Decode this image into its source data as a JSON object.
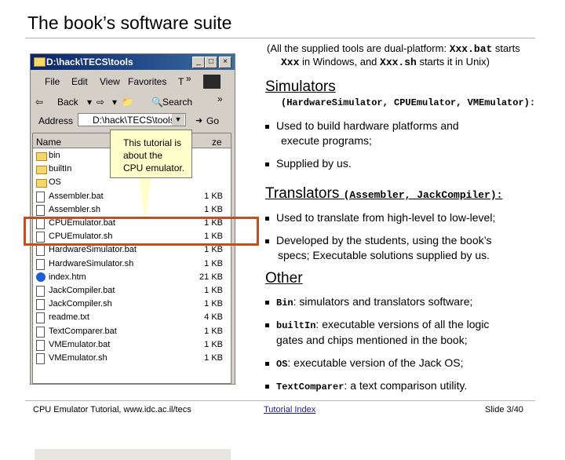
{
  "slide": {
    "title": "The book’s software suite",
    "intro_line1": "(All the supplied tools are dual-platform: ",
    "intro_code1": "Xxx.bat",
    "intro_line1b": " starts",
    "intro_code2": "Xxx",
    "intro_line2": " in Windows, and ",
    "intro_code3": "Xxx.sh",
    "intro_line2b": " starts it in Unix)"
  },
  "explorer": {
    "title": "D:\\hack\\TECS\\tools",
    "menu": [
      "File",
      "Edit",
      "View",
      "Favorites",
      "T",
      "»"
    ],
    "toolbar": [
      "Back",
      "Search",
      "»"
    ],
    "address_label": "Address",
    "address_value": "D:\\hack\\TECS\\tools",
    "go_label": "Go",
    "columns": [
      "Name",
      "ze"
    ],
    "files": [
      {
        "name": "bin",
        "size": "",
        "type": "folder"
      },
      {
        "name": "builtIn",
        "size": "",
        "type": "folder"
      },
      {
        "name": "OS",
        "size": "",
        "type": "folder"
      },
      {
        "name": "Assembler.bat",
        "size": "1 KB",
        "type": "file"
      },
      {
        "name": "Assembler.sh",
        "size": "1 KB",
        "type": "file"
      },
      {
        "name": "CPUEmulator.bat",
        "size": "1 KB",
        "type": "file"
      },
      {
        "name": "CPUEmulator.sh",
        "size": "1 KB",
        "type": "file"
      },
      {
        "name": "HardwareSimulator.bat",
        "size": "1 KB",
        "type": "file"
      },
      {
        "name": "HardwareSimulator.sh",
        "size": "1 KB",
        "type": "file"
      },
      {
        "name": "index.htm",
        "size": "21 KB",
        "type": "ie"
      },
      {
        "name": "JackCompiler.bat",
        "size": "1 KB",
        "type": "file"
      },
      {
        "name": "JackCompiler.sh",
        "size": "1 KB",
        "type": "file"
      },
      {
        "name": "readme.txt",
        "size": "4 KB",
        "type": "file"
      },
      {
        "name": "TextComparer.bat",
        "size": "1 KB",
        "type": "file"
      },
      {
        "name": "VMEmulator.bat",
        "size": "1 KB",
        "type": "file"
      },
      {
        "name": "VMEmulator.sh",
        "size": "1 KB",
        "type": "file"
      }
    ]
  },
  "callout": {
    "line1": "This tutorial is",
    "line2": "about the",
    "line3": "CPU emulator."
  },
  "simulators": {
    "heading": "Simulators",
    "list": "(HardwareSimulator, CPUEmulator, VMEmulator):",
    "b1a": "Used to build hardware platforms and",
    "b1b": "execute programs;",
    "b2": "Supplied by us."
  },
  "translators": {
    "heading": "Translators ",
    "list": "(Assembler, JackCompiler):",
    "b1": "Used to translate from high-level to low-level;",
    "b2a": "Developed by the students, using the book’s",
    "b2b": "specs; Executable solutions supplied by us."
  },
  "other": {
    "heading": "Other",
    "b1_code": "Bin",
    "b1_text": ": simulators and translators software;",
    "b2_code": "builtIn",
    "b2_text": ": executable versions of all the logic",
    "b2_text2": "gates and chips mentioned in the book;",
    "b3_code": "OS",
    "b3_text": ": executable version of the Jack OS;",
    "b4_code": "TextComparer",
    "b4_text": ": a text comparison utility."
  },
  "footer": {
    "left": "CPU Emulator Tutorial, www.idc.ac.il/tecs",
    "mid": "Tutorial Index",
    "right": "Slide 3/40"
  },
  "colors": {
    "highlight": "#c05020",
    "callout_bg": "#ffffcc",
    "titlebar": "#0a246a"
  }
}
